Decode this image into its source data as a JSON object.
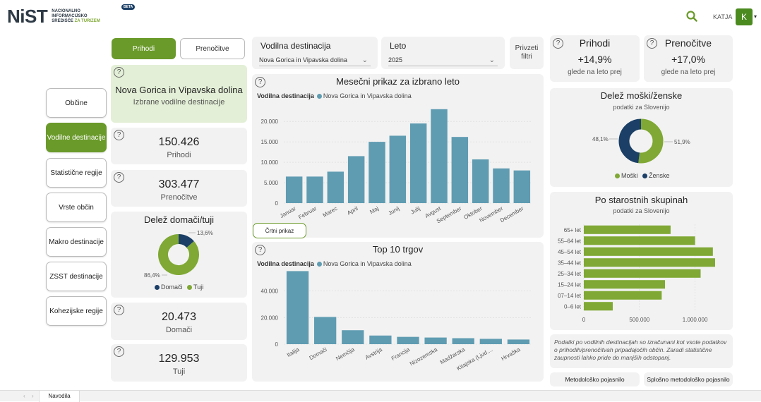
{
  "header": {
    "logo": "NiST",
    "logo_sub": [
      "NACIONALNO",
      "INFORMACIJSKO",
      "SREDIŠČE"
    ],
    "logo_sub_accent": "ZA TURIZEM",
    "beta": "BETA",
    "user_name": "KATJA",
    "user_initial": "K"
  },
  "toggle": {
    "prihodi": "Prihodi",
    "prenocitve": "Prenočitve"
  },
  "nav": [
    "Občine",
    "Vodilne destinacije",
    "Statistične regije",
    "Vrste občin",
    "Makro destinacije",
    "ZSST destinacije",
    "Kohezijske regije"
  ],
  "selection": {
    "title": "Nova Gorica in Vipavska dolina",
    "subtitle": "Izbrane vodilne destinacije"
  },
  "kpis": {
    "prihodi": {
      "value": "150.426",
      "label": "Prihodi"
    },
    "prenocitve": {
      "value": "303.477",
      "label": "Prenočitve"
    },
    "domaci": {
      "value": "20.473",
      "label": "Domači"
    },
    "tuji": {
      "value": "129.953",
      "label": "Tuji"
    }
  },
  "filters": {
    "dest_label": "Vodilna destinacija",
    "dest_value": "Nova Gorica in Vipavska dolina",
    "year_label": "Leto",
    "year_value": "2025",
    "reset": "Privzeti filtri"
  },
  "top_kpis": {
    "prihodi": {
      "title": "Prihodi",
      "value": "+14,9%",
      "sub": "glede na leto prej"
    },
    "prenocitve": {
      "title": "Prenočitve",
      "value": "+17,0%",
      "sub": "glede na leto prej"
    }
  },
  "legend_common": {
    "label": "Vodilna destinacija",
    "series": "Nova Gorica in Vipavska dolina"
  },
  "domaci_tuji": {
    "title": "Delež domači/tuji",
    "legend_domaci": "Domači",
    "legend_tuji": "Tuji"
  },
  "moski_zenske": {
    "title": "Delež moški/ženske",
    "subtitle": "podatki za Slovenijo",
    "legend_moski": "Moški",
    "legend_zenske": "Ženske"
  },
  "starost": {
    "title": "Po starostnih skupinah",
    "subtitle": "podatki za Slovenijo"
  },
  "monthly": {
    "title": "Mesečni prikaz za izbrano leto",
    "button": "Črtni prikaz"
  },
  "top10": {
    "title": "Top 10 trgov"
  },
  "note": "Podatki po vodilnih destinacijah so izračunani kot vsote podatkov o prihodih/prenočitvah pripadajočih občin. Zaradi statistične zaupnosti lahko pride do manjših odstopanj.",
  "footer_buttons": {
    "metod": "Metodološko pojasnilo",
    "splosno": "Splošno metodološko pojasnilo"
  },
  "tabbar": {
    "tab": "Navodila"
  },
  "colors": {
    "green": "#6a9a2a",
    "donut_green": "#7fa834",
    "navy": "#1b3f66",
    "teal": "#5f9cb2",
    "bar_green": "#7fa834"
  },
  "chart_data": [
    {
      "type": "bar",
      "id": "monthly",
      "title": "Mesečni prikaz za izbrano leto",
      "categories": [
        "Januar",
        "Februar",
        "Marec",
        "April",
        "Maj",
        "Junij",
        "Julij",
        "Avgust",
        "September",
        "Oktober",
        "November",
        "December"
      ],
      "values": [
        6500,
        6500,
        7700,
        11500,
        15000,
        16500,
        19500,
        23000,
        16200,
        10700,
        8500,
        8000
      ],
      "yticks": [
        0,
        5000,
        10000,
        15000,
        20000
      ],
      "ytick_labels": [
        "0",
        "5.000",
        "10.000",
        "15.000",
        "20.000"
      ],
      "ylim": [
        0,
        24000
      ]
    },
    {
      "type": "bar",
      "id": "top10",
      "title": "Top 10 trgov",
      "categories": [
        "Italija",
        "Domači",
        "Nemčija",
        "Avstrija",
        "Francija",
        "Nizozemska",
        "Madžarska",
        "Kitajska (Ljud....",
        "Hrvaška"
      ],
      "values": [
        55000,
        20500,
        10500,
        6500,
        5500,
        5000,
        4500,
        4000,
        3500
      ],
      "yticks": [
        0,
        20000,
        40000
      ],
      "ytick_labels": [
        "0",
        "20.000",
        "40.000"
      ],
      "ylim": [
        0,
        60000
      ]
    },
    {
      "type": "pie",
      "id": "domaci_tuji",
      "labels": [
        "Domači",
        "Tuji"
      ],
      "values": [
        13.6,
        86.4
      ],
      "value_labels": [
        "13,6%",
        "86,4%"
      ]
    },
    {
      "type": "pie",
      "id": "moski_zenske",
      "labels": [
        "Moški",
        "Ženske"
      ],
      "values": [
        51.9,
        48.1
      ],
      "value_labels": [
        "51,9%",
        "48,1%"
      ]
    },
    {
      "type": "bar",
      "id": "starost",
      "orientation": "horizontal",
      "categories": [
        "65+ let",
        "55–64 let",
        "45–54 let",
        "35–44 let",
        "25–34 let",
        "15–24 let",
        "07–14 let",
        "0–6 let"
      ],
      "values": [
        780000,
        1000000,
        1160000,
        1180000,
        1050000,
        730000,
        700000,
        260000
      ],
      "xticks": [
        0,
        500000,
        1000000
      ],
      "xtick_labels": [
        "0",
        "500.000",
        "1.000.000"
      ],
      "xlim": [
        0,
        1250000
      ]
    }
  ]
}
